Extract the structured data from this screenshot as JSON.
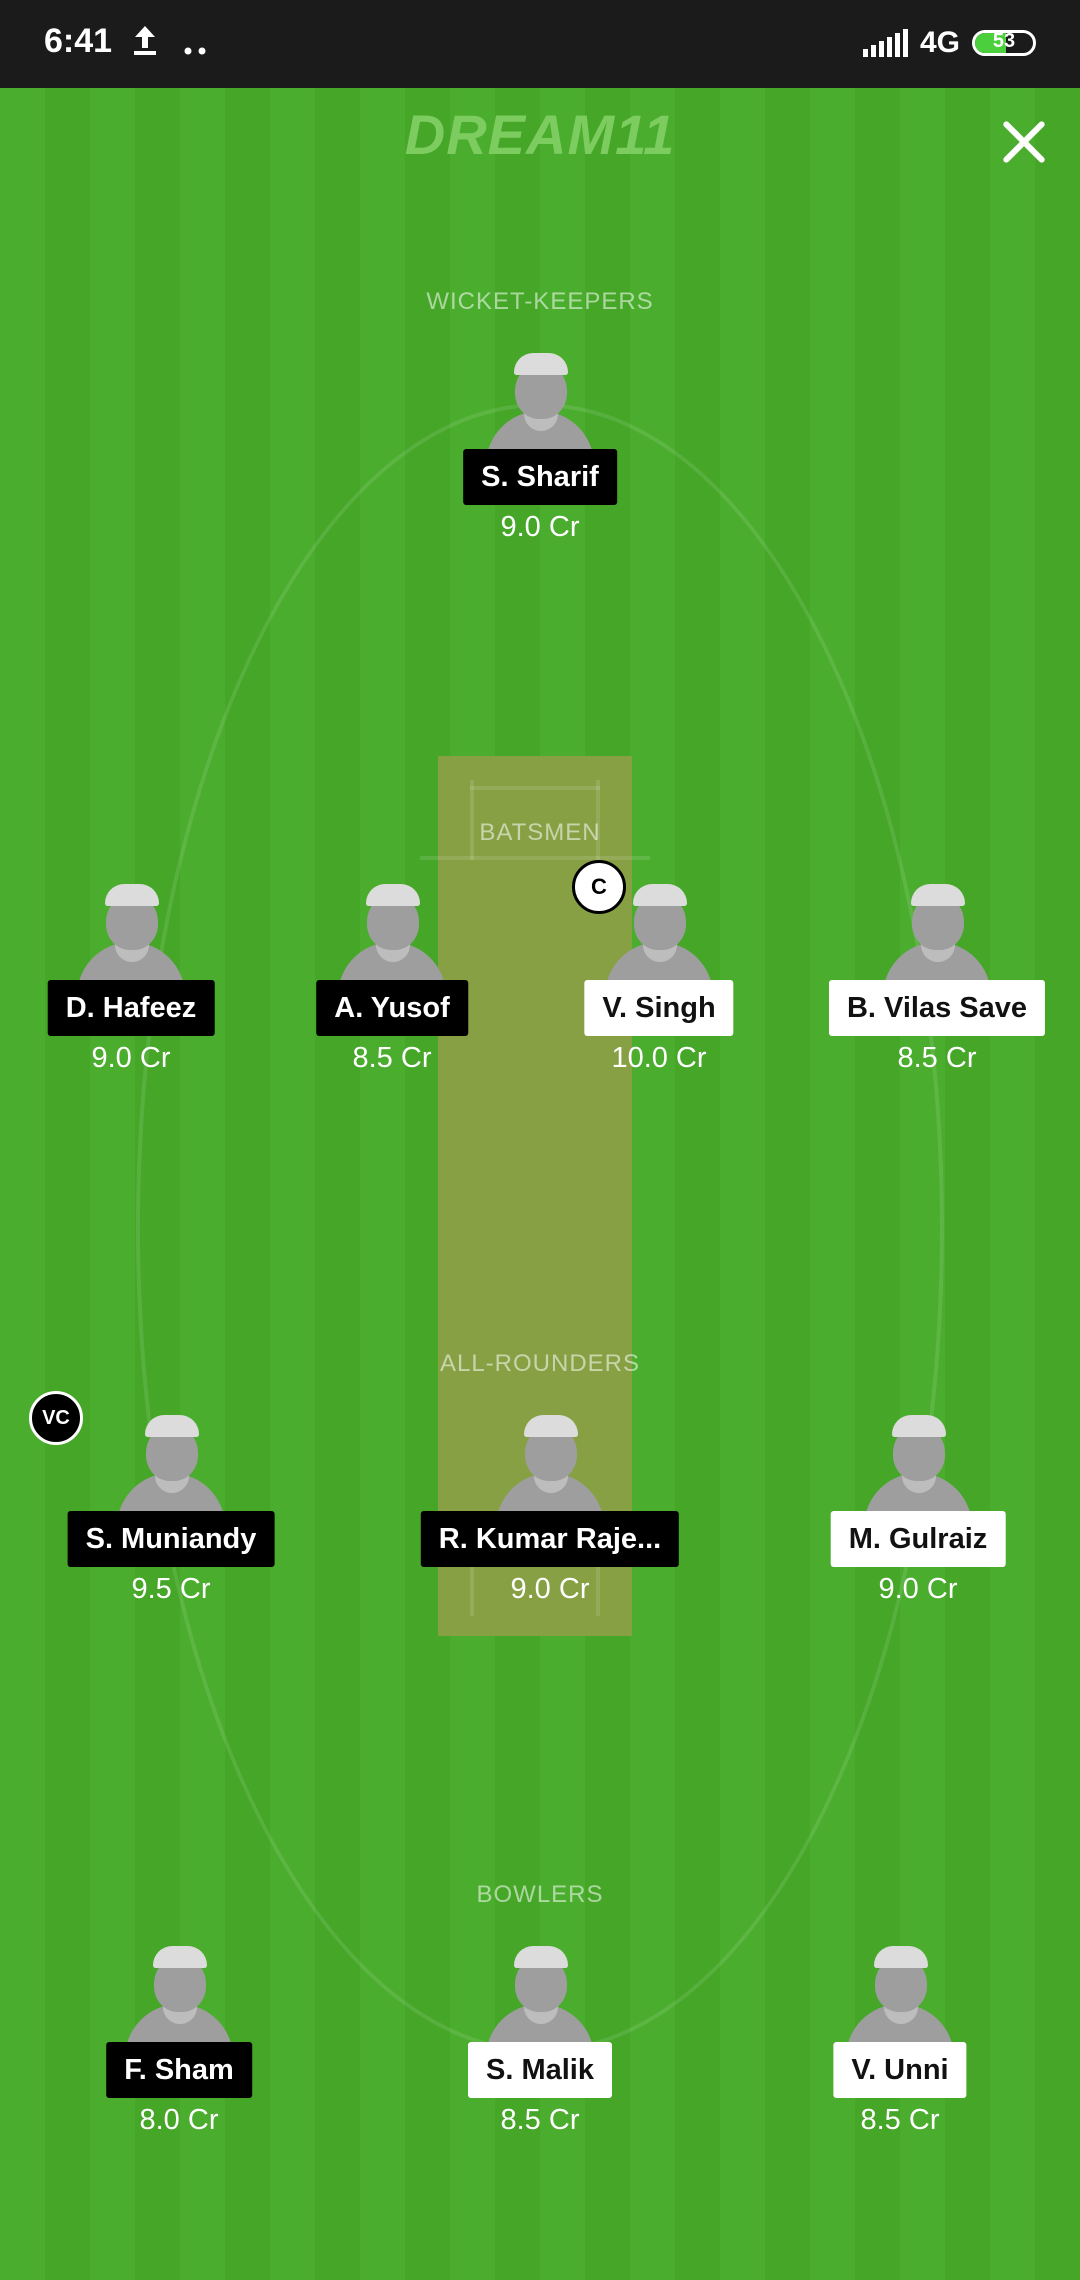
{
  "status_bar": {
    "time": "6:41",
    "left_icons": [
      "upload-icon",
      "more-dots-icon"
    ],
    "network": "4G",
    "battery": "53"
  },
  "header": {
    "logo": "DREAM11",
    "close_icon": "close-icon"
  },
  "sections": {
    "wicket_keepers": "WICKET-KEEPERS",
    "batsmen": "BATSMEN",
    "all_rounders": "ALL-ROUNDERS",
    "bowlers": "BOWLERS"
  },
  "players": {
    "wk": [
      {
        "name": "S. Sharif",
        "credits": "9.0 Cr",
        "team": "dark"
      }
    ],
    "bat": [
      {
        "name": "D. Hafeez",
        "credits": "9.0 Cr",
        "team": "dark"
      },
      {
        "name": "A. Yusof",
        "credits": "8.5 Cr",
        "team": "dark"
      },
      {
        "name": "V. Singh",
        "credits": "10.0 Cr",
        "team": "light",
        "role": "C"
      },
      {
        "name": "B. Vilas Save",
        "credits": "8.5 Cr",
        "team": "light"
      }
    ],
    "ar": [
      {
        "name": "S. Muniandy",
        "credits": "9.5 Cr",
        "team": "dark",
        "role": "VC"
      },
      {
        "name": "R. Kumar Raje...",
        "credits": "9.0 Cr",
        "team": "dark"
      },
      {
        "name": "M. Gulraiz",
        "credits": "9.0 Cr",
        "team": "light"
      }
    ],
    "bowl": [
      {
        "name": "F. Sham",
        "credits": "8.0 Cr",
        "team": "dark"
      },
      {
        "name": "S. Malik",
        "credits": "8.5 Cr",
        "team": "light"
      },
      {
        "name": "V. Unni",
        "credits": "8.5 Cr",
        "team": "light"
      }
    ]
  },
  "colors": {
    "field_green": "#46a82a",
    "pitch": "#86a043",
    "team_dark": "#000000",
    "team_light": "#ffffff"
  }
}
